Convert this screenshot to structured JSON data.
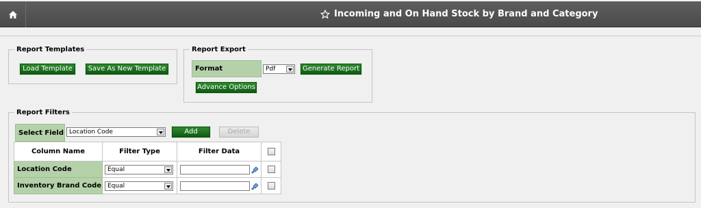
{
  "header": {
    "home_icon": "home-icon",
    "star_icon": "star-icon",
    "title": "Incoming and On Hand Stock by Brand and Category"
  },
  "report_templates": {
    "legend": "Report Templates",
    "load_label": "Load Template",
    "save_label": "Save As New Template"
  },
  "report_export": {
    "legend": "Report Export",
    "format_label": "Format",
    "format_value": "Pdf",
    "generate_label": "Generate Report",
    "advance_label": "Advance Options"
  },
  "report_filters": {
    "legend": "Report Filters",
    "select_field_label": "Select Field",
    "select_field_value": "Location Code",
    "add_label": "Add",
    "delete_label": "Delete",
    "columns": [
      "Column Name",
      "Filter Type",
      "Filter Data"
    ],
    "rows": [
      {
        "name": "Location Code",
        "filter_type": "Equal",
        "filter_data": ""
      },
      {
        "name": "Inventory Brand Code",
        "filter_type": "Equal",
        "filter_data": ""
      }
    ]
  },
  "colors": {
    "header_bg": "#545454",
    "button_green": "#1a6b1d",
    "label_green": "#b5d1aa"
  }
}
